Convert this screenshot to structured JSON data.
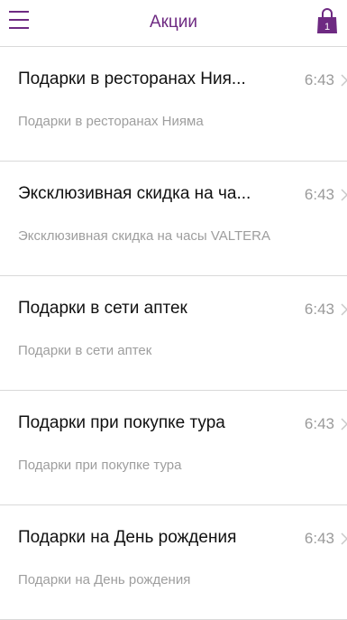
{
  "header": {
    "title": "Акции",
    "cart_badge": "1",
    "icons": {
      "menu": "hamburger-menu-icon",
      "cart": "shopping-bag-icon"
    }
  },
  "colors": {
    "accent": "#6e2a82",
    "divider": "#d9d9d9",
    "muted": "#9e9e9e"
  },
  "items": [
    {
      "title": "Подарки в ресторанах Ния...",
      "time": "6:43",
      "subtitle": "Подарки в ресторанах Нияма"
    },
    {
      "title": "Эксклюзивная скидка на ча...",
      "time": "6:43",
      "subtitle": "Эксклюзивная скидка на часы VALTERA"
    },
    {
      "title": "Подарки в сети аптек",
      "time": "6:43",
      "subtitle": "Подарки в сети аптек"
    },
    {
      "title": "Подарки при покупке тура",
      "time": "6:43",
      "subtitle": "Подарки при покупке тура"
    },
    {
      "title": "Подарки на День рождения",
      "time": "6:43",
      "subtitle": "Подарки на День рождения"
    }
  ]
}
